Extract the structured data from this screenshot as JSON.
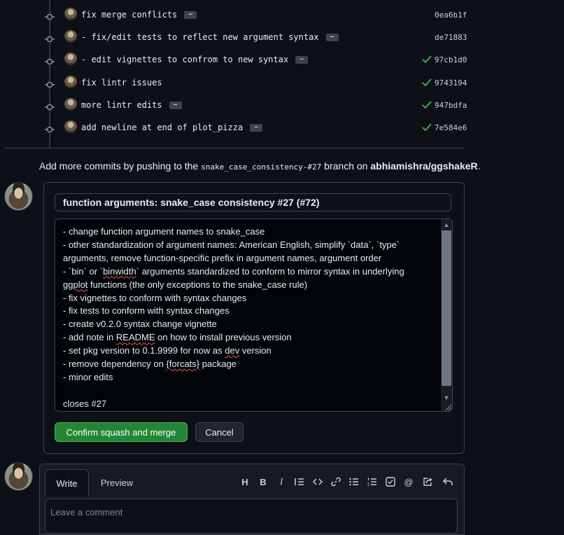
{
  "commits": [
    {
      "message": "fix merge conflicts",
      "has_ellipsis": true,
      "verified": false,
      "sha": "0ea6b1f"
    },
    {
      "message": "- fix/edit tests to reflect new argument syntax",
      "has_ellipsis": true,
      "verified": false,
      "sha": "de71883"
    },
    {
      "message": "- edit vignettes to confrom to new syntax",
      "has_ellipsis": true,
      "verified": true,
      "sha": "97cb1d0"
    },
    {
      "message": "fix lintr issues",
      "has_ellipsis": false,
      "verified": true,
      "sha": "9743194"
    },
    {
      "message": "more lintr edits",
      "has_ellipsis": true,
      "verified": true,
      "sha": "947bdfa"
    },
    {
      "message": "add newline at end of plot_pizza",
      "has_ellipsis": true,
      "verified": true,
      "sha": "7e584e6"
    }
  ],
  "push_note": {
    "prefix": "Add more commits by pushing to the ",
    "branch": "snake_case_consistency-#27",
    "middle": " branch on ",
    "repo": "abhiamishra/ggshakeR",
    "suffix": "."
  },
  "merge": {
    "title_value": "function arguments: snake_case consistency #27 (#72)",
    "message_lines": [
      "- change function argument names to snake_case",
      "- other standardization of argument names: American English, simplify `data`, `type`",
      "arguments, remove function-specific prefix in argument names, argument order",
      "- `bin` or `binwidth` arguments standardized to conform to mirror syntax in underlying",
      "ggplot functions (the only exceptions to the snake_case rule)",
      "- fix vignettes to conform with syntax changes",
      "- fix tests to conform with syntax changes",
      "- create v0.2.0 syntax change vignette",
      "- add note in README on how to install previous version",
      "- set pkg version to 0.1.9999 for now as dev version",
      "- remove dependency on {forcats} package",
      "- minor edits",
      "",
      "closes #27"
    ],
    "confirm_label": "Confirm squash and merge",
    "cancel_label": "Cancel"
  },
  "comment": {
    "tab_write": "Write",
    "tab_preview": "Preview",
    "placeholder": "Leave a comment",
    "toolbar": [
      "heading-icon",
      "bold-icon",
      "italic-icon",
      "quote-icon",
      "code-icon",
      "link-icon",
      "unordered-list-icon",
      "ordered-list-icon",
      "task-list-icon",
      "mention-icon",
      "reference-icon",
      "reply-icon"
    ]
  },
  "colors": {
    "background": "#0d1117",
    "border": "#3d444d",
    "accent_green": "#238636",
    "check_green": "#3fb950"
  }
}
